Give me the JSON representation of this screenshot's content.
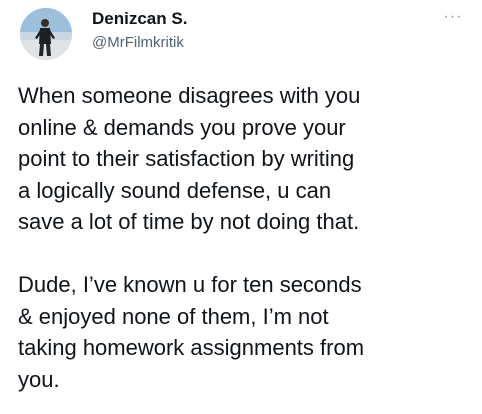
{
  "tweet": {
    "author": {
      "name": "Denizcan S.",
      "handle": "@MrFilmkritik"
    },
    "more_icon": "more-horizontal-icon",
    "more_label": "···",
    "paragraphs": [
      {
        "lines": [
          "When someone disagrees with you",
          "online & demands you prove your",
          "point to their satisfaction by writing",
          "a logically sound defense, u can",
          "save a lot of time by not doing that."
        ]
      },
      {
        "lines": [
          "Dude, I’ve known u for ten seconds",
          "& enjoyed none of them, I’m not",
          "taking homework assignments from",
          "you."
        ]
      }
    ]
  },
  "colors": {
    "text": "#0f1419",
    "secondary_text": "#536471",
    "background": "#ffffff"
  }
}
